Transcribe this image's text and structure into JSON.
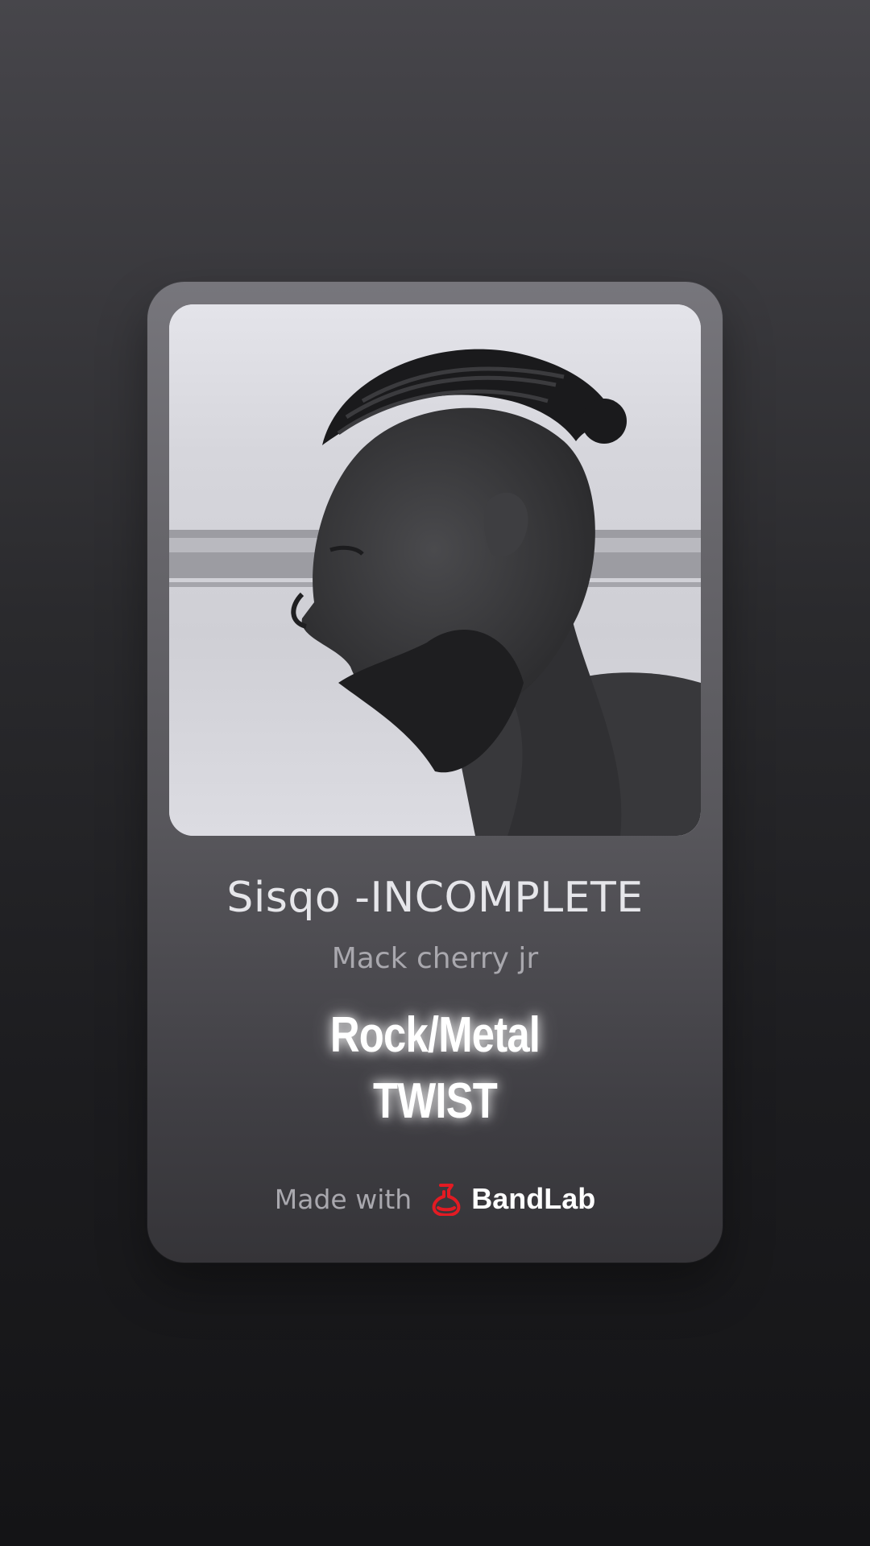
{
  "track": {
    "title": "Sisqo -INCOMPLETE",
    "artist": "Mack cherry jr",
    "genre_line1": "Rock/Metal",
    "genre_line2": "TWIST"
  },
  "footer": {
    "made_with": "Made with",
    "brand": "BandLab",
    "brand_color": "#e31b23"
  },
  "cover": {
    "icon": "artist-photo-grayscale"
  }
}
